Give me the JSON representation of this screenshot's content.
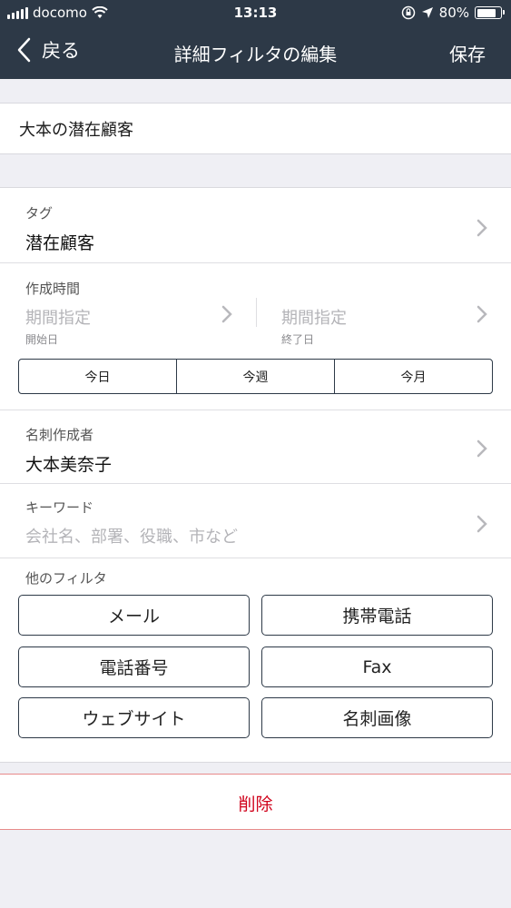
{
  "status_bar": {
    "carrier": "docomo",
    "time": "13:13",
    "battery": "80%",
    "battery_level": 0.8
  },
  "nav": {
    "back_label": "戻る",
    "title": "詳細フィルタの編集",
    "save_label": "保存"
  },
  "filter_name": "大本の潜在顧客",
  "tag": {
    "label": "タグ",
    "value": "潜在顧客"
  },
  "created_time": {
    "label": "作成時間",
    "start_placeholder": "期間指定",
    "start_caption": "開始日",
    "end_placeholder": "期間指定",
    "end_caption": "終了日",
    "quick_ranges": [
      "今日",
      "今週",
      "今月"
    ]
  },
  "creator": {
    "label": "名刺作成者",
    "value": "大本美奈子"
  },
  "keyword": {
    "label": "キーワード",
    "placeholder": "会社名、部署、役職、市など"
  },
  "other_filters": {
    "label": "他のフィルタ",
    "buttons": [
      "メール",
      "携帯電話",
      "電話番号",
      "Fax",
      "ウェブサイト",
      "名刺画像"
    ]
  },
  "delete_label": "削除",
  "colors": {
    "header_bg": "#2d3947",
    "accent": "#2d3947",
    "delete_red": "#d0021b",
    "background": "#efeff4"
  }
}
